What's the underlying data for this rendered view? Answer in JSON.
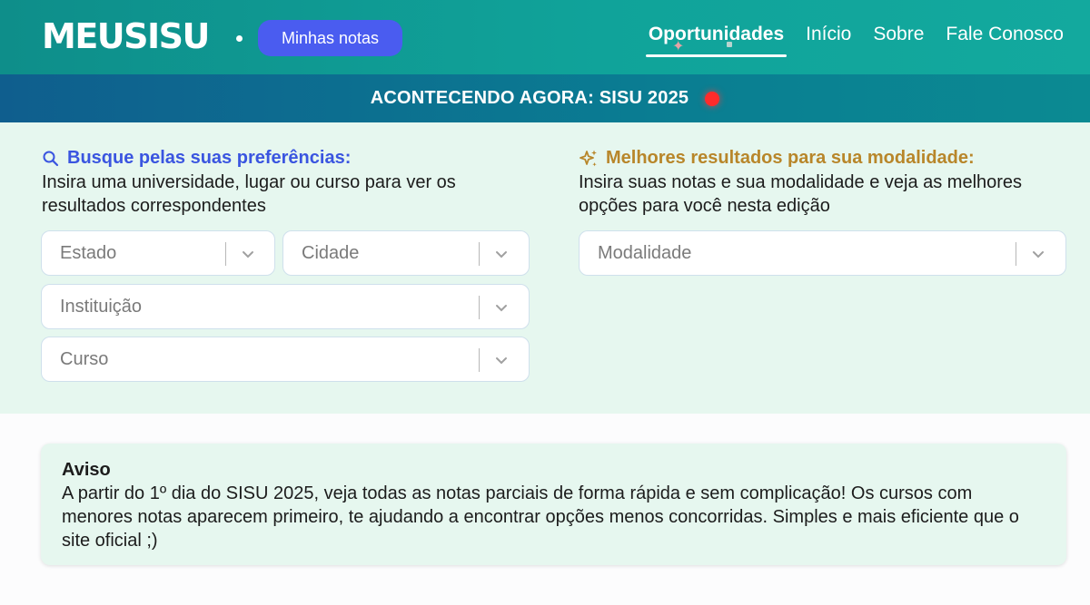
{
  "header": {
    "logo": "MEUSISU",
    "notes_button": "Minhas notas",
    "nav": [
      "Oportunidades",
      "Início",
      "Sobre",
      "Fale Conosco"
    ],
    "active_nav": "Oportunidades"
  },
  "banner": {
    "text": "ACONTECENDO AGORA: SISU 2025"
  },
  "search": {
    "title": "Busque pelas suas preferências:",
    "description": "Insira uma universidade, lugar ou curso para ver os resultados correspondentes",
    "estado_placeholder": "Estado",
    "cidade_placeholder": "Cidade",
    "instituicao_placeholder": "Instituição",
    "curso_placeholder": "Curso"
  },
  "modalidade": {
    "title": "Melhores resultados para sua modalidade:",
    "description": "Insira suas notas e sua modalidade e veja as melhores opções para você nesta edição",
    "placeholder": "Modalidade"
  },
  "aviso": {
    "title": "Aviso",
    "text": "A partir do 1º dia do SISU 2025, veja todas as notas parciais de forma rápida e sem complicação! Os cursos com menores notas aparecem primeiro, te ajudando a encontrar opções menos concorridas. Simples e mais eficiente que o site oficial ;)"
  },
  "colors": {
    "header": "#10a39a",
    "banner": "#0a7d92",
    "accent_blue": "#4a5cf0",
    "accent_gold": "#b8862a",
    "live": "#ff2b2b",
    "section_bg": "#e6f7ef"
  },
  "icons": [
    "search-icon",
    "sparkles-icon",
    "chevron-down-icon"
  ]
}
